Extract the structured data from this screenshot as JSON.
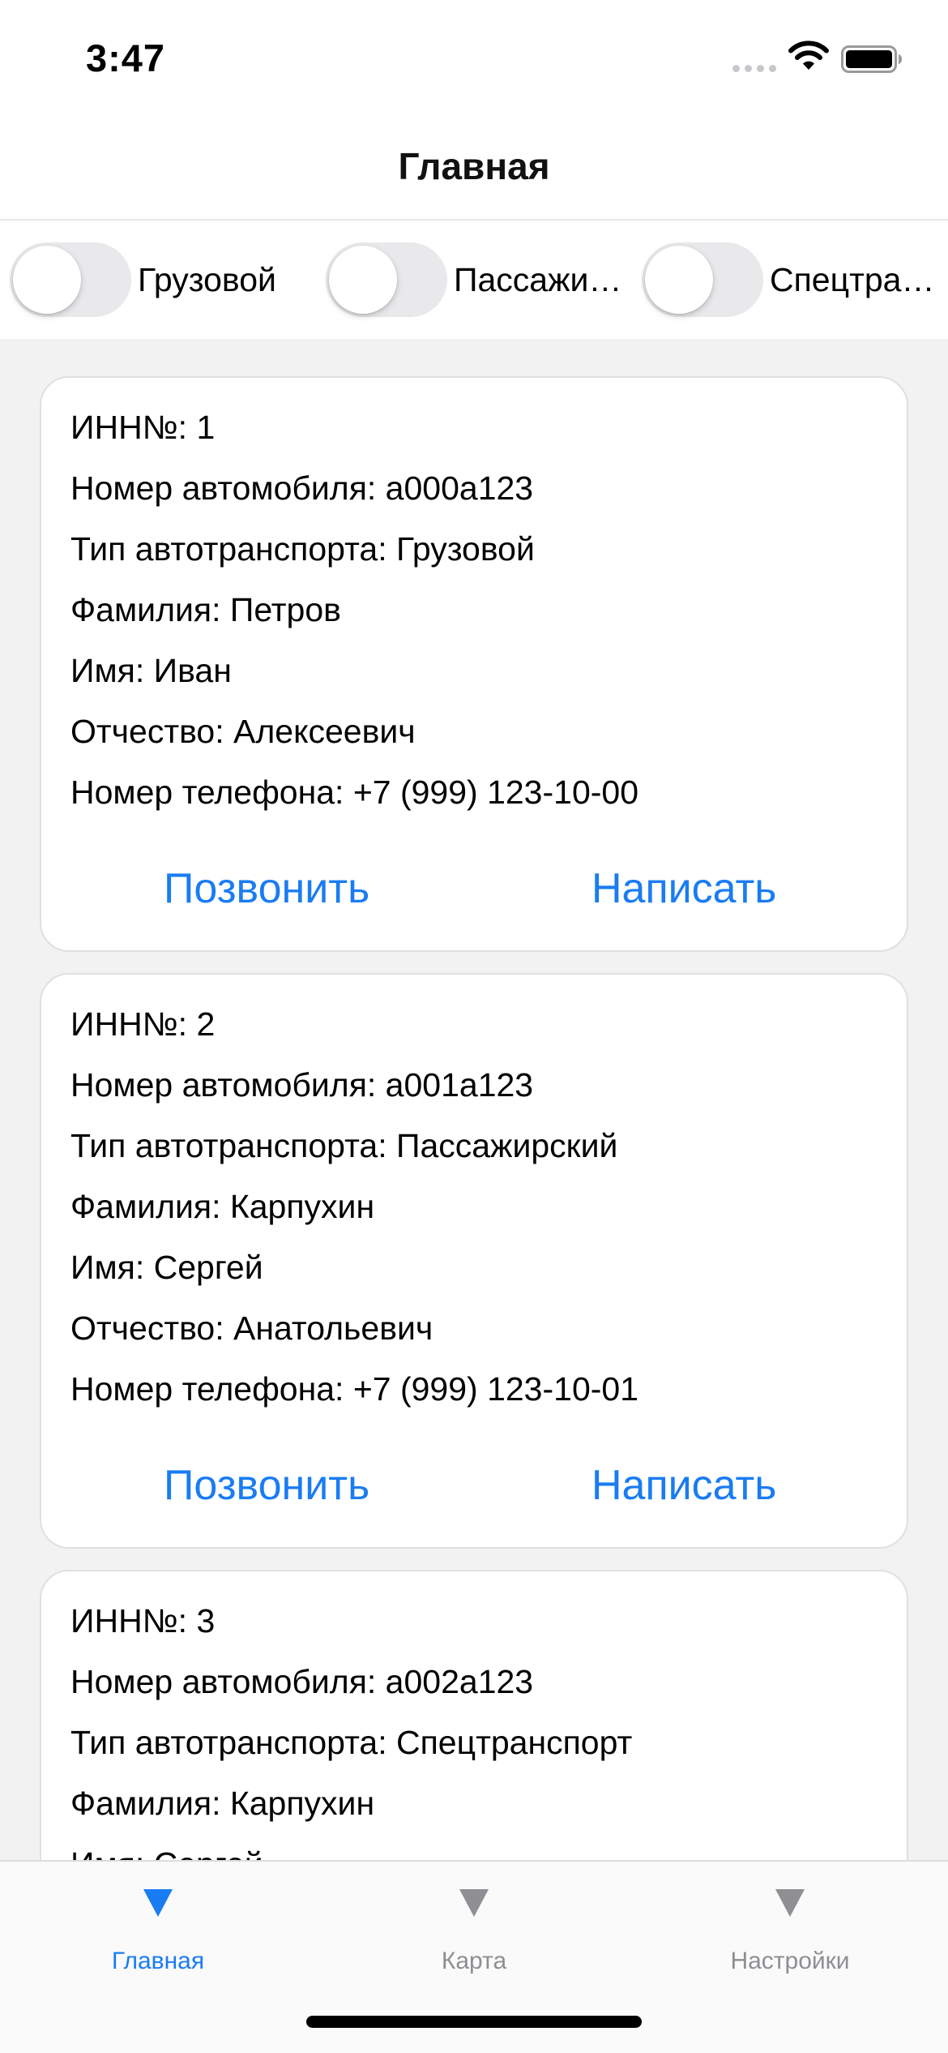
{
  "status_bar": {
    "time": "3:47"
  },
  "nav": {
    "title": "Главная"
  },
  "filters": [
    {
      "label": "Грузовой",
      "on": false
    },
    {
      "label": "Пассажи…",
      "on": false
    },
    {
      "label": "Спецтра…",
      "on": false
    }
  ],
  "cards": [
    {
      "inn": "ИНН№: 1",
      "car_number": "Номер автомобиля: a000a123",
      "vehicle_type": "Тип автотранспорта: Грузовой",
      "last_name": "Фамилия: Петров",
      "first_name": "Имя: Иван",
      "patronymic": "Отчество: Алексеевич",
      "phone": "Номер телефона: +7 (999) 123-10-00",
      "call_label": "Позвонить",
      "write_label": "Написать"
    },
    {
      "inn": "ИНН№: 2",
      "car_number": "Номер автомобиля: a001a123",
      "vehicle_type": "Тип автотранспорта: Пассажирский",
      "last_name": "Фамилия: Карпухин",
      "first_name": "Имя: Сергей",
      "patronymic": "Отчество: Анатольевич",
      "phone": "Номер телефона: +7 (999) 123-10-01",
      "call_label": "Позвонить",
      "write_label": "Написать"
    },
    {
      "inn": "ИНН№: 3",
      "car_number": "Номер автомобиля: a002a123",
      "vehicle_type": "Тип автотранспорта: Спецтранспорт",
      "last_name": "Фамилия: Карпухин",
      "first_name": "Имя: Сергей"
    }
  ],
  "tabs": [
    {
      "label": "Главная",
      "icon": "triangle-down-icon",
      "active": true
    },
    {
      "label": "Карта",
      "icon": "triangle-down-icon",
      "active": false
    },
    {
      "label": "Настройки",
      "icon": "triangle-down-icon",
      "active": false
    }
  ],
  "colors": {
    "accent": "#1a7cf2",
    "inactive_tab": "#8e8e93",
    "background": "#f2f2f2"
  }
}
